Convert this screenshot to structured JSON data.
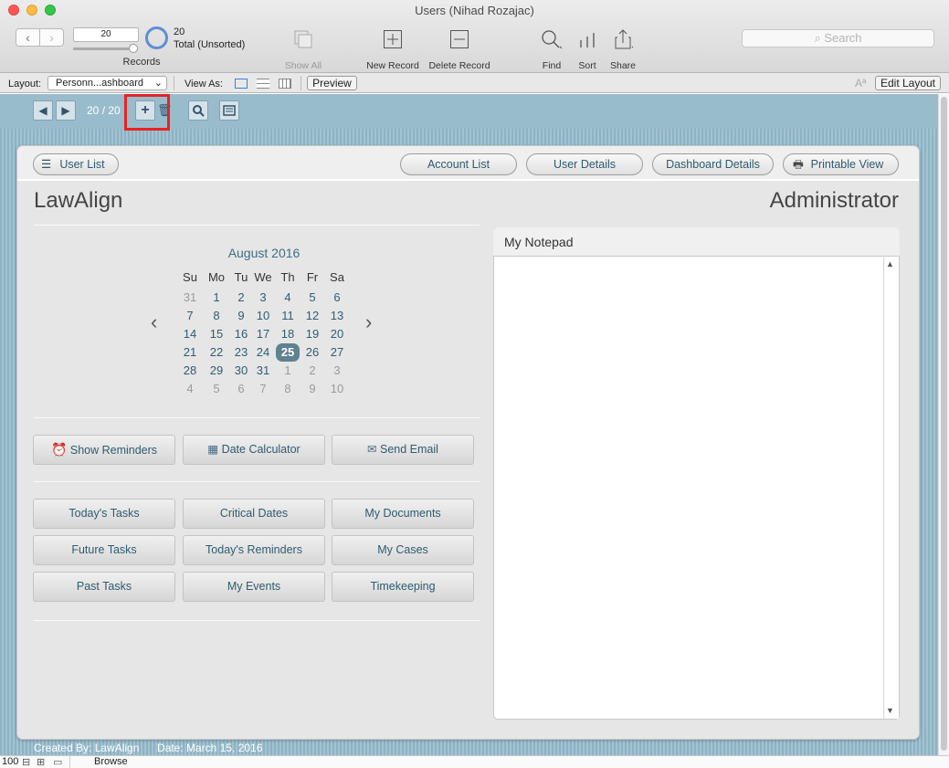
{
  "window": {
    "title": "Users (Nihad Rozajac)"
  },
  "toolbar": {
    "record_field": "20",
    "records_label": "Records",
    "found_count": "20",
    "sort_status": "Total (Unsorted)",
    "show_all": "Show All",
    "new_record": "New Record",
    "delete_record": "Delete Record",
    "find": "Find",
    "sort": "Sort",
    "share": "Share",
    "search_placeholder": "Search"
  },
  "layoutbar": {
    "layout_label": "Layout:",
    "layout_value": "Personn...ashboard",
    "view_as_label": "View As:",
    "preview": "Preview",
    "edit_layout": "Edit Layout"
  },
  "statusbar": {
    "current": "20",
    "total": "20"
  },
  "nav": {
    "user_list": "User List",
    "account_list": "Account List",
    "user_details": "User Details",
    "dashboard_details": "Dashboard Details",
    "printable_view": "Printable View"
  },
  "header": {
    "app_title": "LawAlign",
    "role": "Administrator"
  },
  "calendar": {
    "month": "August 2016",
    "weekdays": [
      "Su",
      "Mo",
      "Tu",
      "We",
      "Th",
      "Fr",
      "Sa"
    ],
    "weeks": [
      [
        "31",
        "1",
        "2",
        "3",
        "4",
        "5",
        "6"
      ],
      [
        "7",
        "8",
        "9",
        "10",
        "11",
        "12",
        "13"
      ],
      [
        "14",
        "15",
        "16",
        "17",
        "18",
        "19",
        "20"
      ],
      [
        "21",
        "22",
        "23",
        "24",
        "25",
        "26",
        "27"
      ],
      [
        "28",
        "29",
        "30",
        "31",
        "1",
        "2",
        "3"
      ],
      [
        "4",
        "5",
        "6",
        "7",
        "8",
        "9",
        "10"
      ]
    ],
    "today": "25"
  },
  "actions": {
    "show_reminders": "Show Reminders",
    "date_calculator": "Date Calculator",
    "send_email": "Send Email"
  },
  "grid": {
    "todays_tasks": "Today's Tasks",
    "critical_dates": "Critical Dates",
    "my_documents": "My Documents",
    "future_tasks": "Future Tasks",
    "todays_reminders": "Today's Reminders",
    "my_cases": "My Cases",
    "past_tasks": "Past Tasks",
    "my_events": "My Events",
    "timekeeping": "Timekeeping"
  },
  "notepad": {
    "title": "My Notepad"
  },
  "footer": {
    "created_by": "Created By: LawAlign",
    "date": "Date: March 15, 2016"
  },
  "bottombar": {
    "zoom": "100",
    "mode": "Browse"
  }
}
